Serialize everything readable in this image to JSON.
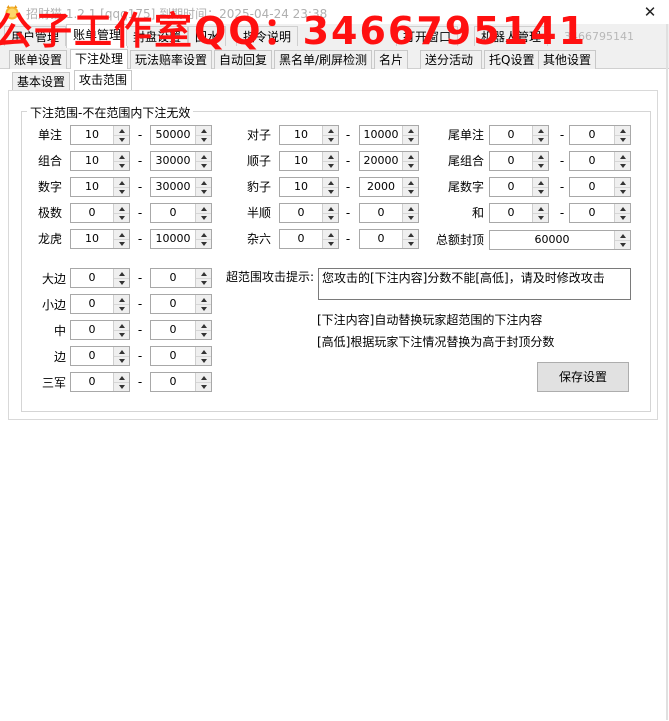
{
  "window": {
    "title": "招财猫 1.2.1 [qqq175] 到期时间：2025-04-24 23:38",
    "close_glyph": "✕",
    "watermark": "公子工作室QQ：3466795141"
  },
  "main_tabs": [
    {
      "label": "用户管理"
    },
    {
      "label": "账单管理"
    },
    {
      "label": "封盘设置"
    },
    {
      "label": "回水"
    },
    {
      "label": "指令说明"
    },
    {
      "label": "打开窗口"
    },
    {
      "label": "机器人管理"
    }
  ],
  "main_tabs_overflow": "3466795141",
  "sub_tabs": [
    {
      "label": "账单设置"
    },
    {
      "label": "下注处理"
    },
    {
      "label": "玩法赔率设置"
    },
    {
      "label": "自动回复"
    },
    {
      "label": "黑名单/刷屏检测"
    },
    {
      "label": "名片"
    },
    {
      "label": "送分活动"
    },
    {
      "label": "托Q设置"
    },
    {
      "label": "其他设置"
    }
  ],
  "inner_tabs": [
    {
      "label": "基本设置"
    },
    {
      "label": "攻击范围"
    }
  ],
  "group_title": "下注范围-不在范围内下注无效",
  "dash": "-",
  "ranges_col1": [
    {
      "label": "单注",
      "min": "10",
      "max": "50000"
    },
    {
      "label": "组合",
      "min": "10",
      "max": "30000"
    },
    {
      "label": "数字",
      "min": "10",
      "max": "30000"
    },
    {
      "label": "极数",
      "min": "0",
      "max": "0"
    },
    {
      "label": "龙虎",
      "min": "10",
      "max": "10000"
    }
  ],
  "ranges_col2": [
    {
      "label": "对子",
      "min": "10",
      "max": "10000"
    },
    {
      "label": "顺子",
      "min": "10",
      "max": "20000"
    },
    {
      "label": "豹子",
      "min": "10",
      "max": "2000"
    },
    {
      "label": "半顺",
      "min": "0",
      "max": "0"
    },
    {
      "label": "杂六",
      "min": "0",
      "max": "0"
    }
  ],
  "ranges_col3": [
    {
      "label": "尾单注",
      "min": "0",
      "max": "0"
    },
    {
      "label": "尾组合",
      "min": "0",
      "max": "0"
    },
    {
      "label": "尾数字",
      "min": "0",
      "max": "0"
    },
    {
      "label": "和",
      "min": "0",
      "max": "0"
    }
  ],
  "total_cap": {
    "label": "总额封顶",
    "value": "60000"
  },
  "ranges_lower": [
    {
      "label": "大边",
      "min": "0",
      "max": "0"
    },
    {
      "label": "小边",
      "min": "0",
      "max": "0"
    },
    {
      "label": "中",
      "min": "0",
      "max": "0"
    },
    {
      "label": "边",
      "min": "0",
      "max": "0"
    },
    {
      "label": "三军",
      "min": "0",
      "max": "0"
    }
  ],
  "attack_prompt": {
    "label": "超范围攻击提示:",
    "value": "您攻击的[下注内容]分数不能[高低]，请及时修改攻击"
  },
  "notes": [
    "[下注内容]自动替换玩家超范围的下注内容",
    "[高低]根据玩家下注情况替换为高于封顶分数"
  ],
  "save_label": "保存设置",
  "colors": {
    "watermark": "#ff1010",
    "window_bg": "#f0f0f0",
    "panel_bg": "#ffffff"
  }
}
